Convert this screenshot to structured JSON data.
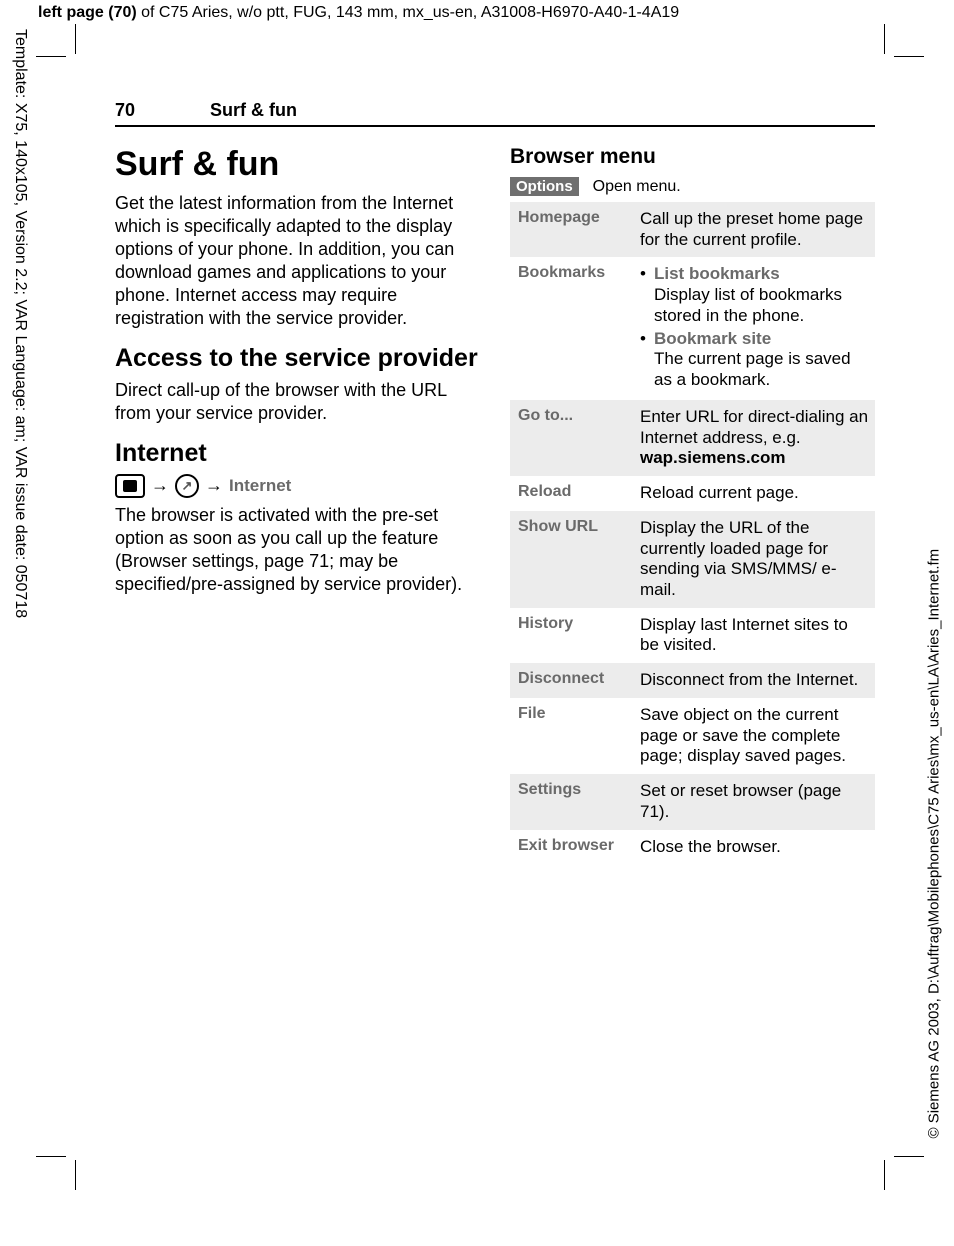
{
  "crop_header": {
    "prefix": "left page (70)",
    "rest": " of C75 Aries, w/o ptt, FUG, 143 mm, mx_us-en, A31008-H6970-A40-1-4A19"
  },
  "side_left": "Template: X75, 140x105, Version 2.2; VAR Language: am; VAR issue date: 050718",
  "side_right": "©  Siemens AG 2003, D:\\Auftrag\\Mobilephones\\C75 Aries\\mx_us-en\\LA\\Aries_Internet.fm",
  "running_head": {
    "page_number": "70",
    "section": "Surf & fun"
  },
  "left_col": {
    "title": "Surf & fun",
    "intro": "Get the latest information from the Internet which is specifically adapted to the display options of your phone. In addition, you can download games and applications to your phone. Internet access may require registration with the service provider.",
    "h2a": "Access to the service provider",
    "p2": "Direct call-up of the browser with the URL from your service provider.",
    "h2b": "Internet",
    "nav_label": "Internet",
    "p3": "The browser is activated with the pre-set option as soon as you call up the feature (Browser settings, page 71; may be specified/pre-assigned by service provider)."
  },
  "right_col": {
    "heading": "Browser menu",
    "options_label": "Options",
    "options_text": "Open menu.",
    "rows": [
      {
        "k": "Homepage",
        "v_plain": "Call up the preset home page for the current profile."
      },
      {
        "k": "Bookmarks",
        "bullets": [
          {
            "head": "List bookmarks",
            "body": "Display list of bookmarks stored in the phone."
          },
          {
            "head": "Bookmark site",
            "body": "The current page is saved as a bookmark."
          }
        ]
      },
      {
        "k": "Go to...",
        "v_pre": "Enter URL for direct-dialing an Internet address, e.g. ",
        "v_bold": "wap.siemens.com"
      },
      {
        "k": "Reload",
        "v_plain": "Reload current page."
      },
      {
        "k": "Show URL",
        "v_plain": "Display the URL of the currently loaded page for sending via SMS/MMS/ e-mail."
      },
      {
        "k": "History",
        "v_plain": "Display last Internet sites to be visited."
      },
      {
        "k": "Disconnect",
        "v_plain": "Disconnect from the Internet."
      },
      {
        "k": "File",
        "v_plain": "Save object on the current page or save the complete page; display saved pages."
      },
      {
        "k": "Settings",
        "v_plain": "Set or reset browser (page 71)."
      },
      {
        "k": "Exit browser",
        "v_plain": "Close the browser."
      }
    ]
  }
}
